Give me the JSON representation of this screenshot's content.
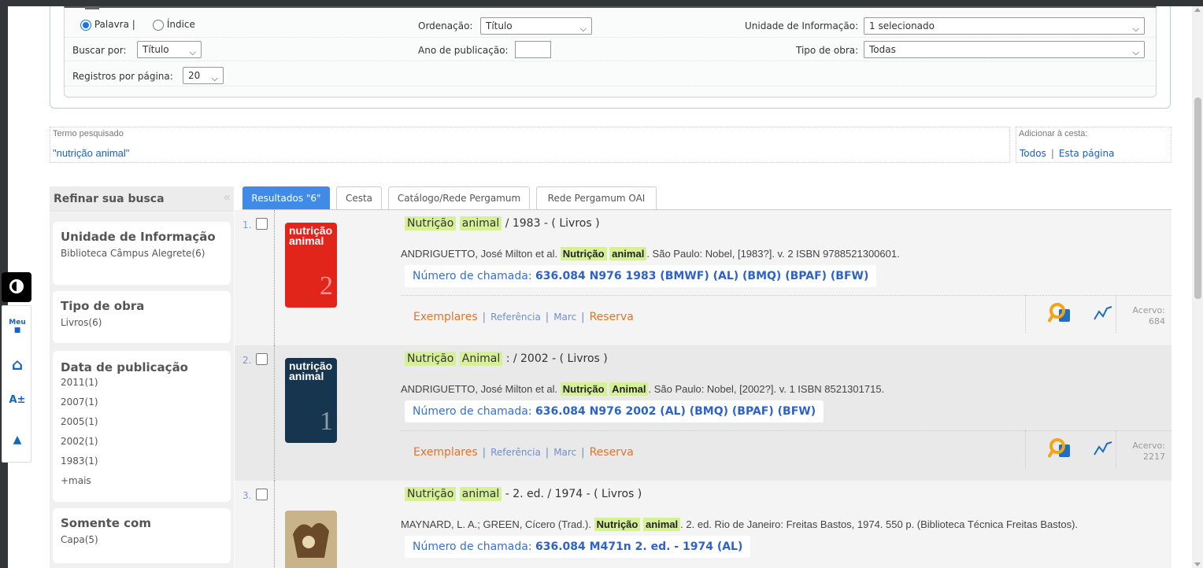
{
  "colors": {
    "accent": "#3f8be5",
    "highlight": "#d6f097",
    "link_orange": "#e0742b",
    "link_blue": "#1f5fb8"
  },
  "form": {
    "radio_palavra": "Palavra |",
    "radio_indice": "Índice",
    "ordenacao_label": "Ordenação:",
    "ordenacao_value": "Título",
    "unidade_label": "Unidade de Informação:",
    "unidade_value": "1 selecionado",
    "buscar_label": "Buscar por:",
    "buscar_value": "Título",
    "ano_label": "Ano de publicação:",
    "tipo_label": "Tipo de obra:",
    "tipo_value": "Todas",
    "registros_label": "Registros por página:",
    "registros_value": "20"
  },
  "termo": {
    "legend": "Termo pesquisado",
    "value": "\"nutrição animal\""
  },
  "cesta": {
    "legend": "Adicionar à cesta:",
    "todos": "Todos",
    "sep": "|",
    "pagina": "Esta página"
  },
  "sidebar": {
    "title": "Refinar sua busca",
    "facets": [
      {
        "title": "Unidade de Informação",
        "items": [
          "Biblioteca Câmpus Alegrete(6)"
        ]
      },
      {
        "title": "Tipo de obra",
        "items": [
          "Livros(6)"
        ]
      },
      {
        "title": "Data de publicação",
        "items": [
          "2011(1)",
          "2007(1)",
          "2005(1)",
          "2002(1)",
          "1983(1)",
          "+mais"
        ]
      },
      {
        "title": "Somente com",
        "items": [
          "Capa(5)"
        ]
      }
    ]
  },
  "a11y": {
    "meu": "Meu",
    "font": "A±"
  },
  "tabs": [
    "Resultados \"6\"",
    "Cesta",
    "Catálogo/Rede Pergamum",
    "Rede Pergamum OAI"
  ],
  "results": [
    {
      "num": "1.",
      "cover_text": "nutrição animal",
      "cover_vol": "2",
      "title_hl1": "Nutrição",
      "title_hl2": "animal",
      "title_rest": "/ 1983 - ( Livros )",
      "ref_pre": "ANDRIGUETTO, José Milton et al.",
      "ref_hl1": "Nutrição",
      "ref_hl2": "animal",
      "ref_post": ". São Paulo: Nobel, [1983?]. v. 2 ISBN 9788521300601.",
      "call_label": "Número de chamada:",
      "call_value": "636.084 N976 1983 (BMWF) (AL) (BMQ) (BPAF) (BFW)",
      "links": {
        "exemplares": "Exemplares",
        "referencia": "Referência",
        "marc": "Marc",
        "reserva": "Reserva"
      },
      "acervo_label": "Acervo:",
      "acervo_value": "684"
    },
    {
      "num": "2.",
      "cover_text": "nutrição animal",
      "cover_vol": "1",
      "title_hl1": "Nutrição",
      "title_hl2": "Animal",
      "title_rest": ": / 2002 - ( Livros )",
      "ref_pre": "ANDRIGUETTO, José Milton et al.",
      "ref_hl1": "Nutrição",
      "ref_hl2": "Animal",
      "ref_post": ". São Paulo: Nobel, [2002?]. v. 1 ISBN 8521301715.",
      "call_label": "Número de chamada:",
      "call_value": "636.084 N976 2002 (AL) (BMQ) (BPAF) (BFW)",
      "links": {
        "exemplares": "Exemplares",
        "referencia": "Referência",
        "marc": "Marc",
        "reserva": "Reserva"
      },
      "acervo_label": "Acervo:",
      "acervo_value": "2217"
    },
    {
      "num": "3.",
      "title_hl1": "Nutrição",
      "title_hl2": "animal",
      "title_rest": "- 2. ed. / 1974 - ( Livros )",
      "ref_pre": "MAYNARD, L. A.; GREEN, Cícero (Trad.).",
      "ref_hl1": "Nutrição",
      "ref_hl2": "animal",
      "ref_post": ". 2. ed. Rio de Janeiro: Freitas Bastos, 1974. 550 p. (Biblioteca Técnica Freitas Bastos).",
      "call_label": "Número de chamada:",
      "call_value": "636.084 M471n 2. ed. - 1974 (AL)"
    }
  ]
}
